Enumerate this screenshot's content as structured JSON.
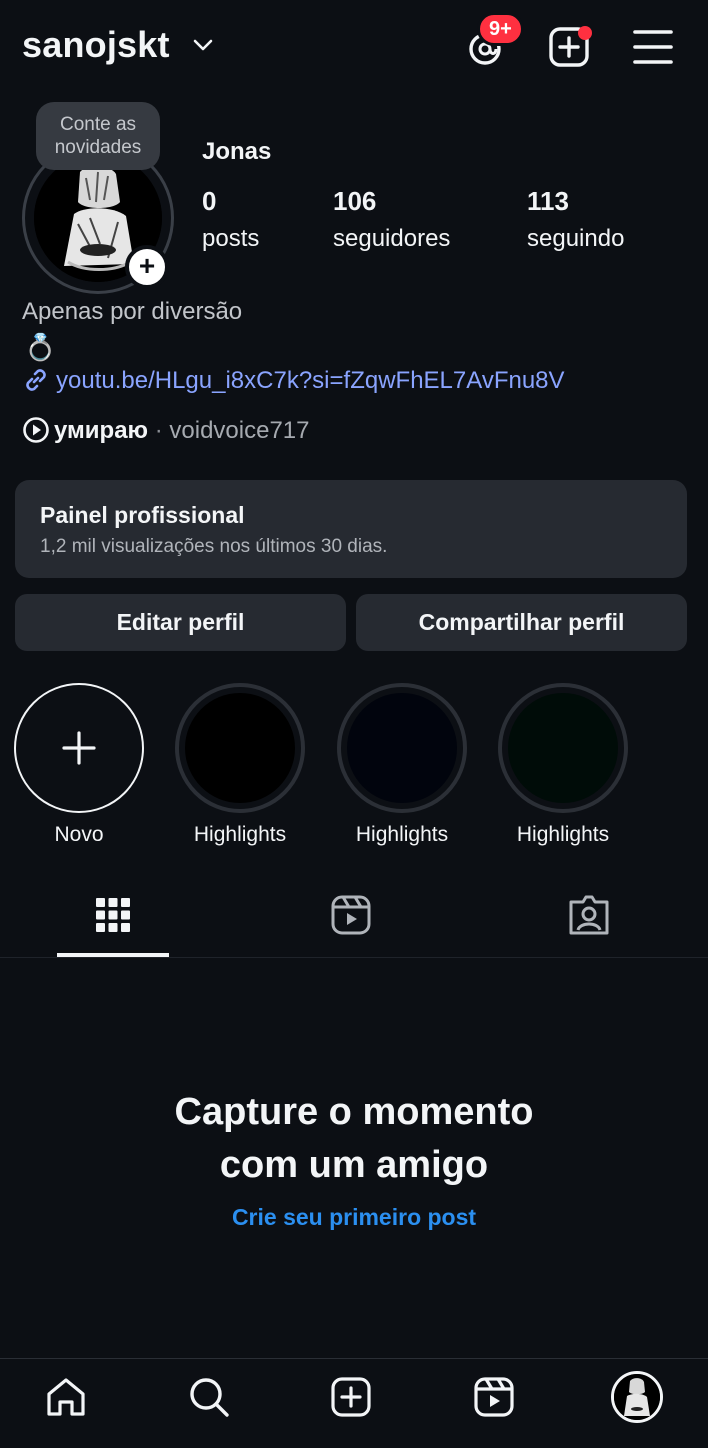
{
  "header": {
    "username": "sanojskt",
    "notification_badge": "9+",
    "icons": [
      "chevron-down-icon",
      "threads-icon",
      "create-post-icon",
      "menu-icon"
    ]
  },
  "profile": {
    "tooltip": "Conte as novidades",
    "display_name": "Jonas",
    "stats": [
      {
        "value": "0",
        "label": "posts"
      },
      {
        "value": "106",
        "label": "seguidores"
      },
      {
        "value": "113",
        "label": "seguindo"
      }
    ],
    "bio_line": "Apenas por diversão",
    "bio_emoji": "💍",
    "link": "youtu.be/HLgu_i8xC7k?si=fZqwFhEL7AvFnu8V",
    "music_title": "умираю",
    "music_separator": "·",
    "music_account": "voidvoice717"
  },
  "dashboard": {
    "title": "Painel profissional",
    "subtitle": "1,2 mil visualizações nos últimos 30 dias."
  },
  "buttons": {
    "edit": "Editar perfil",
    "share": "Compartilhar perfil"
  },
  "highlights": [
    {
      "label": "Novo"
    },
    {
      "label": "Highlights"
    },
    {
      "label": "Highlights"
    },
    {
      "label": "Highlights"
    }
  ],
  "tabs": [
    "grid-icon",
    "reels-icon",
    "tagged-icon"
  ],
  "empty_state": {
    "title_line1": "Capture o momento",
    "title_line2": "com um amigo",
    "cta": "Crie seu primeiro post"
  },
  "bottom_nav": [
    "home-icon",
    "search-icon",
    "create-icon",
    "reels-icon",
    "profile-avatar"
  ],
  "colors": {
    "background": "#0c0f14",
    "badge": "#ff3040",
    "link": "#8aa4ff",
    "cta": "#2b8ff0",
    "surface": "#262a31"
  }
}
